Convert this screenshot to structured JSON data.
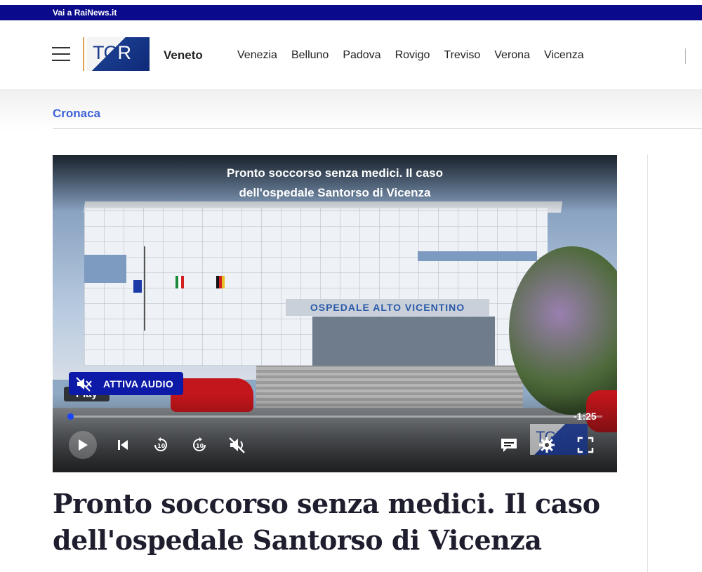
{
  "topbar": {
    "link_label": "Vai a RaiNews.it"
  },
  "header": {
    "logo_text_prefix": "TG",
    "logo_text_suffix": "R",
    "region": "Veneto",
    "nav": [
      "Venezia",
      "Belluno",
      "Padova",
      "Rovigo",
      "Treviso",
      "Verona",
      "Vicenza"
    ]
  },
  "section": {
    "label": "Cronaca"
  },
  "video": {
    "overlay_title_line1": "Pronto soccorso senza medici. Il caso",
    "overlay_title_line2": "dell'ospedale Santorso di Vicenza",
    "building_sign": "OSPEDALE ALTO VICENTINO",
    "audio_button_label": "ATTIVA AUDIO",
    "play_tooltip": "Play",
    "remaining_time": "-1:25",
    "progress_fraction": 0.0,
    "watermark_text": "TGR",
    "controls": [
      "play-icon",
      "skip-back-icon",
      "rewind-10-icon",
      "forward-10-icon",
      "mute-icon",
      "subtitles-icon",
      "settings-gear-icon",
      "fullscreen-icon"
    ]
  },
  "article": {
    "headline": "Pronto soccorso senza medici. Il caso dell'ospedale Santorso di Vicenza"
  },
  "colors": {
    "brand_blue": "#0a0a8c",
    "section_link": "#3f63d8",
    "audio_button": "#0d1aa8"
  }
}
